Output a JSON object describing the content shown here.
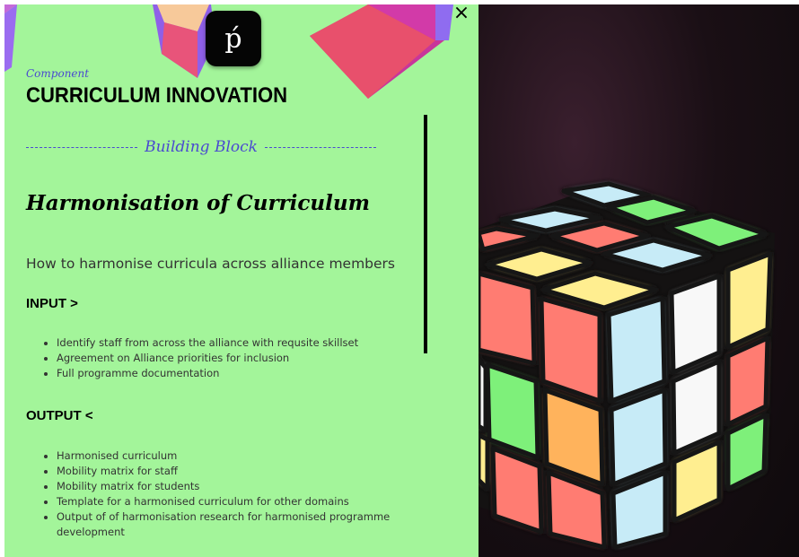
{
  "close": {
    "symbol": "×"
  },
  "logo": {
    "glyph": "ṕ"
  },
  "component": {
    "label": "Component",
    "title": "CURRICULUM INNOVATION"
  },
  "building_block": {
    "label": "Building Block",
    "title": "Harmonisation of Curriculum",
    "description": "How to harmonise curricula across alliance members"
  },
  "input": {
    "heading": "INPUT >",
    "items": [
      "Identify staff from across the alliance with requsite skillset",
      "Agreement on Alliance priorities for inclusion",
      "Full programme documentation"
    ]
  },
  "output": {
    "heading": "OUTPUT <",
    "items": [
      "Harmonised curriculum",
      "Mobility matrix for staff",
      "Mobility matrix for students",
      "Template for a harmonised curriculum for other domains",
      "Output of of harmonisation research for harmonised programme development"
    ]
  },
  "colors": {
    "panel_bg": "#a3f59a",
    "accent": "#4a4ad0",
    "cube_red": "#ff7b72",
    "cube_yellow": "#ffee90",
    "cube_blue": "#c7ebf7",
    "cube_green": "#7ef07a",
    "cube_white": "#f8f8f8",
    "cube_orange": "#ffb35c"
  },
  "decor": {
    "image": "rubiks-cube-image"
  }
}
